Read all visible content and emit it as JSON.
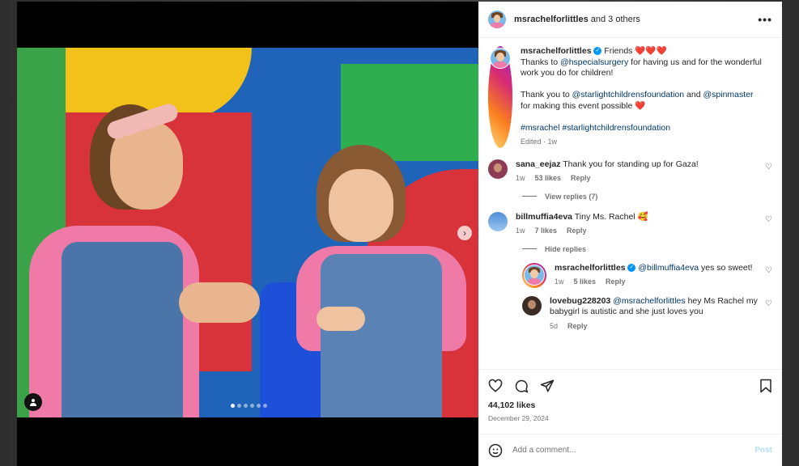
{
  "post": {
    "header_user": "msrachelforlittles",
    "header_suffix": " and 3 others",
    "caption_user": "msrachelforlittles",
    "caption_line1": "Friends ❤️❤️❤️",
    "caption_p1_a": "Thanks to ",
    "caption_p1_mention": "@hspecialsurgery",
    "caption_p1_b": " for having us and for the wonderful work you do for children!",
    "caption_p2_a": "Thank you to ",
    "caption_p2_mention1": "@starlightchildrensfoundation",
    "caption_p2_and": " and ",
    "caption_p2_mention2": "@spinmaster",
    "caption_p2_b": " for making this event possible ❤️",
    "hashtag1": "#msrachel",
    "hashtag2": "#starlightchildrensfoundation",
    "edited": "Edited · 1w",
    "likes": "44,102 likes",
    "date": "December 29, 2024"
  },
  "comments": [
    {
      "user": "sana_eejaz",
      "text": "Thank you for standing up for Gaza!",
      "time": "1w",
      "likes": "53 likes",
      "reply": "Reply"
    },
    {
      "user": "billmuffia4eva",
      "text": "Tiny Ms. Rachel 🥰",
      "time": "1w",
      "likes": "7 likes",
      "reply": "Reply"
    }
  ],
  "view_replies": "View replies (7)",
  "hide_replies": "Hide replies",
  "replies": [
    {
      "user": "msrachelforlittles",
      "mention": "@billmuffia4eva",
      "text": " yes so sweet!",
      "time": "1w",
      "likes": "5 likes",
      "reply": "Reply"
    },
    {
      "user": "lovebug228203",
      "mention": "@msrachelforlittles",
      "text": " hey Ms Rachel my babygirl is autistic and she just loves you",
      "time": "5d",
      "reply": "Reply"
    }
  ],
  "add_comment": {
    "placeholder": "Add a comment...",
    "post_label": "Post"
  },
  "carousel": {
    "slides": 6,
    "active_index": 0
  }
}
